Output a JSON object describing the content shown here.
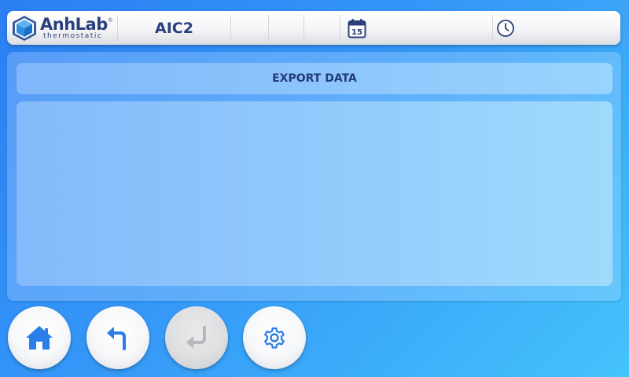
{
  "header": {
    "brand": "AnhLab",
    "brand_registered": "®",
    "brand_subtitle": "thermostatic",
    "device_name": "AIC2",
    "date_icon": "calendar-icon",
    "calendar_day": "15",
    "date_value": "",
    "time_icon": "clock-icon",
    "time_value": ""
  },
  "screen": {
    "title": "EXPORT DATA"
  },
  "footer_buttons": [
    {
      "id": "home",
      "icon": "home-icon",
      "enabled": true
    },
    {
      "id": "back",
      "icon": "back-arrow-icon",
      "enabled": true
    },
    {
      "id": "enter",
      "icon": "enter-icon",
      "enabled": false
    },
    {
      "id": "settings",
      "icon": "gear-icon",
      "enabled": true
    }
  ],
  "colors": {
    "accent_dark_blue": "#2b3f7c",
    "icon_blue": "#2b7de9",
    "disabled_icon": "#b5b7bb",
    "background_start": "#2a7ff2",
    "background_end": "#44c3fb"
  }
}
